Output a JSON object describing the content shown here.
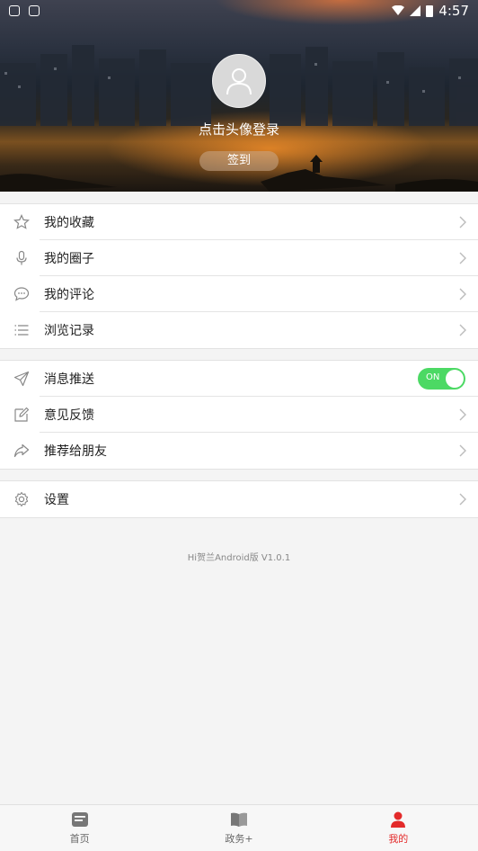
{
  "status_bar": {
    "time": "4:57"
  },
  "profile": {
    "login_prompt": "点击头像登录",
    "checkin_label": "签到"
  },
  "menu_group1": [
    {
      "icon": "star-icon",
      "label": "我的收藏"
    },
    {
      "icon": "microphone-icon",
      "label": "我的圈子"
    },
    {
      "icon": "comment-icon",
      "label": "我的评论"
    },
    {
      "icon": "list-icon",
      "label": "浏览记录"
    }
  ],
  "menu_group2": [
    {
      "icon": "send-icon",
      "label": "消息推送",
      "toggle": "ON"
    },
    {
      "icon": "edit-icon",
      "label": "意见反馈"
    },
    {
      "icon": "share-icon",
      "label": "推荐给朋友"
    }
  ],
  "menu_group3": [
    {
      "icon": "gear-icon",
      "label": "设置"
    }
  ],
  "version": "Hi贺兰Android版 V1.0.1",
  "bottom_nav": [
    {
      "icon": "news-icon",
      "label": "首页",
      "active": false
    },
    {
      "icon": "book-icon",
      "label": "政务+",
      "active": false
    },
    {
      "icon": "person-icon",
      "label": "我的",
      "active": true
    }
  ],
  "colors": {
    "accent": "#e32a2a",
    "toggle_on": "#4cd964"
  }
}
